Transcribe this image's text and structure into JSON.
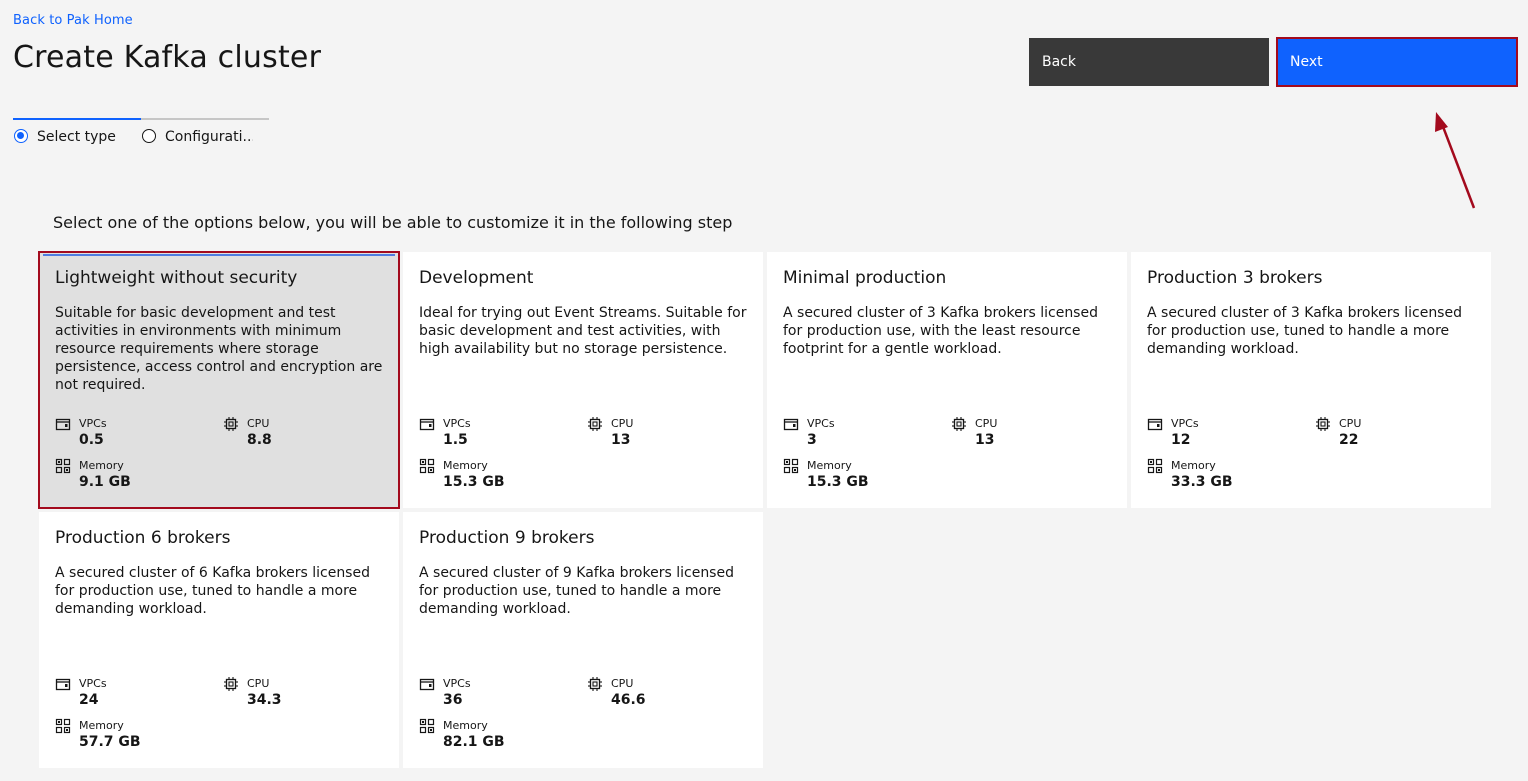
{
  "header": {
    "back_link": "Back to Pak Home",
    "title": "Create Kafka cluster"
  },
  "actions": {
    "back_label": "Back",
    "next_label": "Next"
  },
  "progress": {
    "steps": [
      {
        "label": "Select type",
        "state": "current"
      },
      {
        "label": "Configurati...",
        "state": "incomplete"
      }
    ]
  },
  "intro": "Select one of the options below, you will be able to customize it in the following step",
  "tiles": [
    {
      "title": "Lightweight without security",
      "description": "Suitable for basic development and test activities in environments with minimum resource requirements where storage persistence, access control and encryption are not required.",
      "vpcs_label": "VPCs",
      "vpcs": "0.5",
      "cpu_label": "CPU",
      "cpu": "8.8",
      "memory_label": "Memory",
      "memory": "9.1 GB",
      "selected": true
    },
    {
      "title": "Development",
      "description": "Ideal for trying out Event Streams. Suitable for basic development and test activities, with high availability but no storage persistence.",
      "vpcs_label": "VPCs",
      "vpcs": "1.5",
      "cpu_label": "CPU",
      "cpu": "13",
      "memory_label": "Memory",
      "memory": "15.3 GB"
    },
    {
      "title": "Minimal production",
      "description": "A secured cluster of 3 Kafka brokers licensed for production use, with the least resource footprint for a gentle workload.",
      "vpcs_label": "VPCs",
      "vpcs": "3",
      "cpu_label": "CPU",
      "cpu": "13",
      "memory_label": "Memory",
      "memory": "15.3 GB"
    },
    {
      "title": "Production 3 brokers",
      "description": "A secured cluster of 3 Kafka brokers licensed for production use, tuned to handle a more demanding workload.",
      "vpcs_label": "VPCs",
      "vpcs": "12",
      "cpu_label": "CPU",
      "cpu": "22",
      "memory_label": "Memory",
      "memory": "33.3 GB"
    },
    {
      "title": "Production 6 brokers",
      "description": "A secured cluster of 6 Kafka brokers licensed for production use, tuned to handle a more demanding workload.",
      "vpcs_label": "VPCs",
      "vpcs": "24",
      "cpu_label": "CPU",
      "cpu": "34.3",
      "memory_label": "Memory",
      "memory": "57.7 GB"
    },
    {
      "title": "Production 9 brokers",
      "description": "A secured cluster of 9 Kafka brokers licensed for production use, tuned to handle a more demanding workload.",
      "vpcs_label": "VPCs",
      "vpcs": "36",
      "cpu_label": "CPU",
      "cpu": "46.6",
      "memory_label": "Memory",
      "memory": "82.1 GB"
    }
  ],
  "colors": {
    "accent": "#0f62fe",
    "annotation": "#a30a1d",
    "dark_button": "#393939",
    "page_bg": "#f4f4f4"
  },
  "icons": {
    "vpcs": "vpc-icon",
    "cpu": "chip-icon",
    "memory": "memory-icon"
  }
}
